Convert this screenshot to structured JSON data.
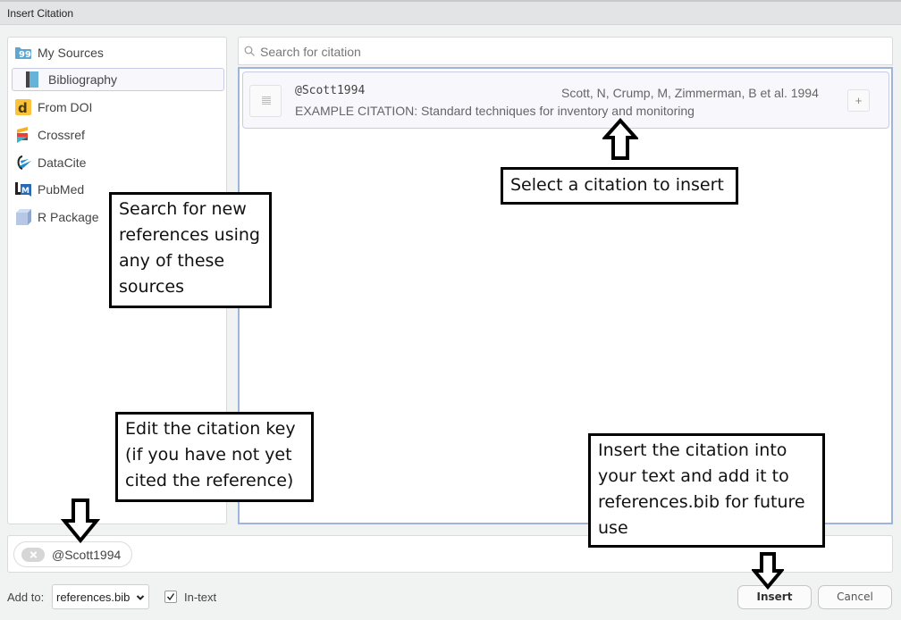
{
  "window": {
    "title": "Insert Citation"
  },
  "sidebar": {
    "items": [
      {
        "label": "My Sources",
        "icon": "my-sources-icon"
      },
      {
        "label": "Bibliography",
        "icon": "bibliography-icon",
        "selected": true
      },
      {
        "label": "From DOI",
        "icon": "doi-icon"
      },
      {
        "label": "Crossref",
        "icon": "crossref-icon"
      },
      {
        "label": "DataCite",
        "icon": "datacite-icon"
      },
      {
        "label": "PubMed",
        "icon": "pubmed-icon"
      },
      {
        "label": "R Package",
        "icon": "r-package-icon"
      }
    ]
  },
  "search": {
    "placeholder": "Search for citation",
    "value": ""
  },
  "results": [
    {
      "key": "@Scott1994",
      "authors": "Scott, N, Crump, M, Zimmerman, B et al. 1994",
      "title": "EXAMPLE CITATION: Standard techniques for inventory and monitoring",
      "add_label": "+"
    }
  ],
  "selected_citation": {
    "key": "@Scott1994"
  },
  "footer": {
    "add_to_label": "Add to:",
    "add_to_value": "references.bib",
    "intext_label": "In-text",
    "intext_checked": true,
    "insert_label": "Insert",
    "cancel_label": "Cancel"
  },
  "callouts": {
    "select": "Select a citation to insert",
    "sources": [
      "Search for new",
      "references using",
      "any of these",
      "sources"
    ],
    "edit_key": [
      "Edit the citation key",
      "(if you have not yet",
      "cited the reference)"
    ],
    "insert": [
      "Insert the citation into",
      "your text and add it to",
      "references.bib for future",
      "use"
    ]
  }
}
